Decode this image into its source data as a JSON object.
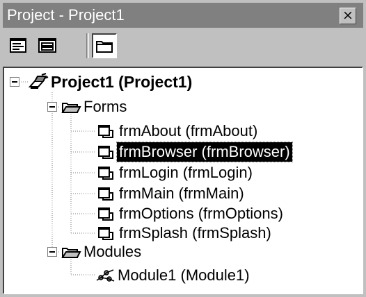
{
  "window": {
    "title": "Project - Project1",
    "close_glyph": "×"
  },
  "toolbar": {
    "buttons": [
      {
        "name": "view-code-icon"
      },
      {
        "name": "view-object-icon"
      },
      {
        "name": "toggle-folders-icon",
        "pressed": true
      }
    ]
  },
  "tree": {
    "project": {
      "label": "Project1 (Project1)",
      "icon": "project-icon",
      "expanded": true
    },
    "forms_folder": {
      "label": "Forms",
      "icon": "folder-open-icon",
      "expanded": true
    },
    "forms": [
      {
        "label": "frmAbout (frmAbout)",
        "icon": "form-icon"
      },
      {
        "label": "frmBrowser (frmBrowser)",
        "icon": "form-icon",
        "selected": true
      },
      {
        "label": "frmLogin (frmLogin)",
        "icon": "form-icon"
      },
      {
        "label": "frmMain (frmMain)",
        "icon": "form-icon"
      },
      {
        "label": "frmOptions (frmOptions)",
        "icon": "form-icon"
      },
      {
        "label": "frmSplash (frmSplash)",
        "icon": "form-icon"
      }
    ],
    "modules_folder": {
      "label": "Modules",
      "icon": "folder-open-icon",
      "expanded": true
    },
    "modules": [
      {
        "label": "Module1 (Module1)",
        "icon": "module-icon"
      }
    ]
  }
}
